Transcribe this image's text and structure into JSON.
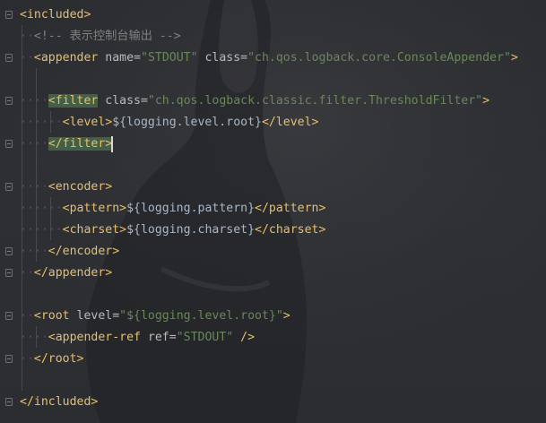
{
  "editor": {
    "lines": {
      "l1": {
        "open": "<included>"
      },
      "l2": {
        "comment": "<!-- 表示控制台输出 -->"
      },
      "l3": {
        "tag_open": "<appender",
        "attr1": " name=",
        "val1": "\"STDOUT\"",
        "attr2": " class=",
        "val2": "\"ch.qos.logback.core.ConsoleAppender\"",
        "close": ">"
      },
      "l5": {
        "tag_open": "<filter",
        "attr1": " class=",
        "val1": "\"ch.qos.logback.classic.filter.ThresholdFilter\"",
        "close": ">"
      },
      "l6": {
        "tag_open": "<level>",
        "text": "${logging.level.root}",
        "tag_close": "</level>"
      },
      "l7": {
        "tag": "</filter>"
      },
      "l9": {
        "tag": "<encoder>"
      },
      "l10": {
        "tag_open": "<pattern>",
        "text": "${logging.pattern}",
        "tag_close": "</pattern>"
      },
      "l11": {
        "tag_open": "<charset>",
        "text": "${logging.charset}",
        "tag_close": "</charset>"
      },
      "l12": {
        "tag": "</encoder>"
      },
      "l13": {
        "tag": "</appender>"
      },
      "l15": {
        "tag_open": "<root",
        "attr1": " level=",
        "val1": "\"${logging.level.root}\"",
        "close": ">"
      },
      "l16": {
        "tag_open": "<appender-ref",
        "attr1": " ref=",
        "val1": "\"STDOUT\"",
        "close": " />"
      },
      "l17": {
        "tag": "</root>"
      },
      "l19": {
        "tag": "</included>"
      }
    }
  },
  "colors": {
    "background": "#2b2d31",
    "tag": "#e8bf6a",
    "attribute": "#bababa",
    "string": "#6a8759",
    "comment": "#808080",
    "text": "#a9b7c6",
    "highlight": "#48674a"
  }
}
